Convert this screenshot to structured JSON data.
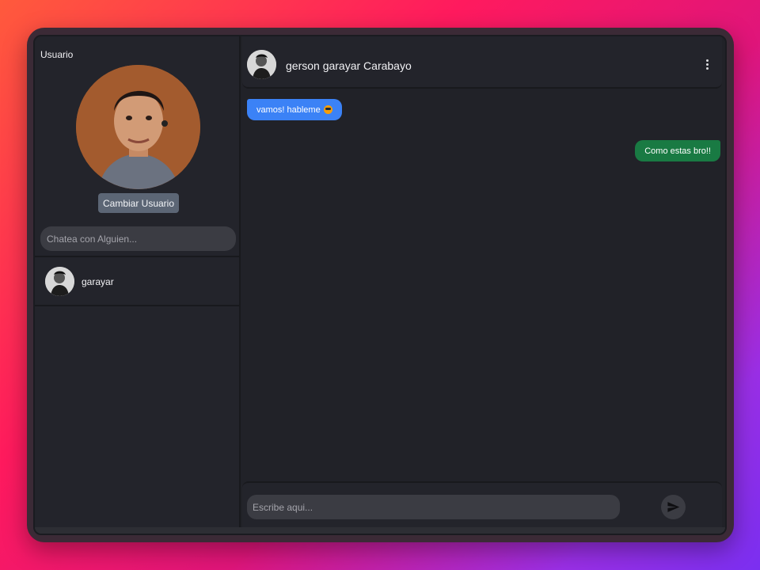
{
  "sidebar": {
    "label": "Usuario",
    "change_user_label": "Cambiar Usuario",
    "search_placeholder": "Chatea con Alguien...",
    "contacts": [
      {
        "name": "garayar"
      }
    ]
  },
  "chat": {
    "contact_name": "gerson garayar Carabayo",
    "messages": [
      {
        "direction": "incoming",
        "text": "vamos! hableme",
        "emoji": "sunglasses-emoji"
      },
      {
        "direction": "outgoing",
        "text": "Como estas bro!!"
      }
    ],
    "input_placeholder": "Escribe aqui...",
    "icons": {
      "menu": "more-vertical-icon",
      "send": "send-icon"
    }
  },
  "colors": {
    "incoming_bubble": "#3b82f6",
    "outgoing_bubble": "#197a43",
    "button": "#5c6675"
  }
}
